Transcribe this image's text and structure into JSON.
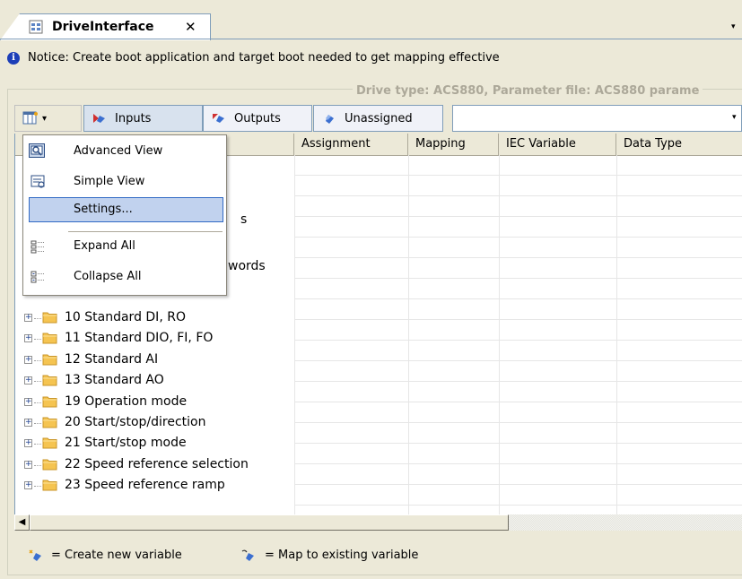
{
  "tab": {
    "title": "DriveInterface",
    "close": "✕",
    "dropdown": "▾"
  },
  "notice": "Notice: Create boot application and target boot needed to get mapping effective",
  "drive_info": "Drive type: ACS880, Parameter file: ACS880 parame",
  "toolbar": {
    "view_arrow": "▾",
    "inputs_label": "Inputs",
    "outputs_label": "Outputs",
    "unassigned_label": "Unassigned",
    "filter_value": "",
    "filter_arrow": "▾"
  },
  "table": {
    "headers": [
      "",
      "Assignment",
      "Mapping",
      "IEC Variable",
      "Data Type"
    ],
    "hidden_fragments": [
      "s",
      "words"
    ],
    "rows": [
      "10 Standard DI, RO",
      "11 Standard DIO, FI, FO",
      "12 Standard AI",
      "13 Standard AO",
      "19 Operation mode",
      "20 Start/stop/direction",
      "21 Start/stop mode",
      "22 Speed reference selection",
      "23 Speed reference ramp"
    ],
    "expander": "+"
  },
  "scroll_left": "◀",
  "menu": {
    "items": [
      "Advanced View",
      "Simple View",
      "Settings...",
      "Expand All",
      "Collapse All"
    ],
    "highlighted": "Settings..."
  },
  "legend": {
    "new_variable": "= Create new variable",
    "map_variable": "= Map to existing variable"
  },
  "colors": {
    "accent": "#316ac5",
    "menu_highlight": "#c1d2ee",
    "folder": "#f5c451",
    "notice_icon": "#1d3fb8"
  },
  "icons": [
    "document-tab-icon",
    "info-icon",
    "column-view-icon",
    "inputs-icon",
    "outputs-icon",
    "unassigned-icon",
    "folder-icon",
    "advanced-view-icon",
    "simple-view-icon",
    "expand-all-icon",
    "collapse-all-icon",
    "create-variable-icon",
    "map-variable-icon"
  ]
}
